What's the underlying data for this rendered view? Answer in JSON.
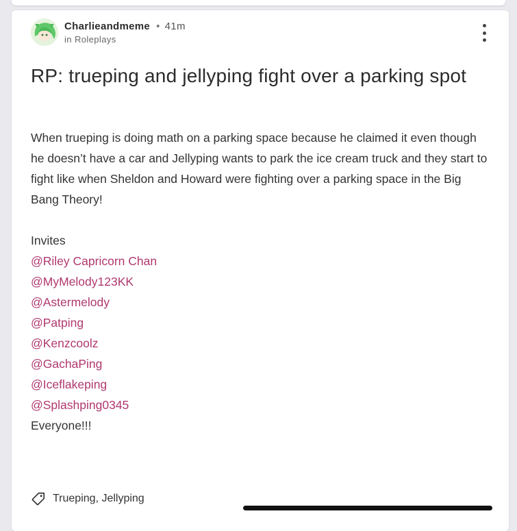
{
  "post": {
    "author": "Charlieandmeme",
    "separator": "•",
    "time": "41m",
    "community_prefix": "in",
    "community": "Roleplays",
    "title": "RP: trueping and jellyping fight over a parking spot",
    "body": "When trueping is doing math on a parking space because he claimed it even though he doesn’t have a car and Jellyping wants to park the ice cream truck and they start to fight like when Sheldon and Howard were fighting over a parking space in the Big Bang Theory!",
    "invites_label": "Invites",
    "mentions": [
      "@Riley Capricorn Chan",
      "@MyMelody123KK",
      "@Astermelody",
      "@Patping",
      "@Kenzcoolz",
      "@GachaPing",
      "@Iceflakeping",
      "@Splashping0345"
    ],
    "closing": "Everyone!!!",
    "tags": "Trueping, Jellyping"
  },
  "icons": {
    "menu": "more-vertical-icon",
    "tag": "tag-icon"
  },
  "colors": {
    "mention": "#b0386f",
    "text": "#333333",
    "background": "#e9e9ee"
  }
}
